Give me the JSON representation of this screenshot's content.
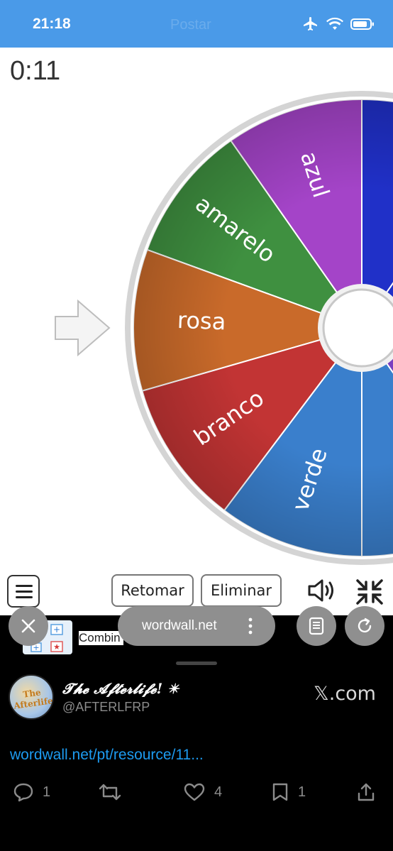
{
  "status_bar": {
    "time": "21:18",
    "ghost_title": "Postar",
    "icons": [
      "airplane-icon",
      "wifi-icon",
      "battery-icon"
    ]
  },
  "game": {
    "timer": "0:11",
    "wheel_segments": [
      {
        "label": "azul",
        "color": "#a444c8"
      },
      {
        "label": "amarelo",
        "color": "#3f9040"
      },
      {
        "label": "rosa",
        "color": "#c96a2a"
      },
      {
        "label": "branco",
        "color": "#c23434"
      },
      {
        "label": "verde",
        "color": "#3a7fcc"
      }
    ],
    "pointer_icon": "arrow-right-icon"
  },
  "game_toolbar": {
    "retomar_label": "Retomar",
    "eliminar_label": "Eliminar",
    "icons": [
      "menu-icon",
      "speaker-icon",
      "shrink-icon"
    ]
  },
  "browser": {
    "url": "wordwall.net",
    "tab_preview_text": "Combin",
    "icons": [
      "close-icon",
      "more-vertical-icon",
      "reader-icon",
      "reload-icon"
    ]
  },
  "share_sheet": {
    "account_name": "𝓣𝓱𝓮 𝓐𝓯𝓽𝓮𝓻𝓵𝓲𝓯𝓮! ✴",
    "account_handle": "@AFTERLFRP",
    "avatar_text": "The Afterlife",
    "site": "𝕏.com",
    "link": "wordwall.net/pt/resource/11...",
    "actions": {
      "replies": "1",
      "reposts": "",
      "likes": "4",
      "bookmarks": "1"
    }
  },
  "colors": {
    "status_bar": "#4a9ae8",
    "link": "#1d9bf0",
    "wheel_top_right": "#2030c8",
    "wheel_right_mid": "#3a9a8a"
  }
}
